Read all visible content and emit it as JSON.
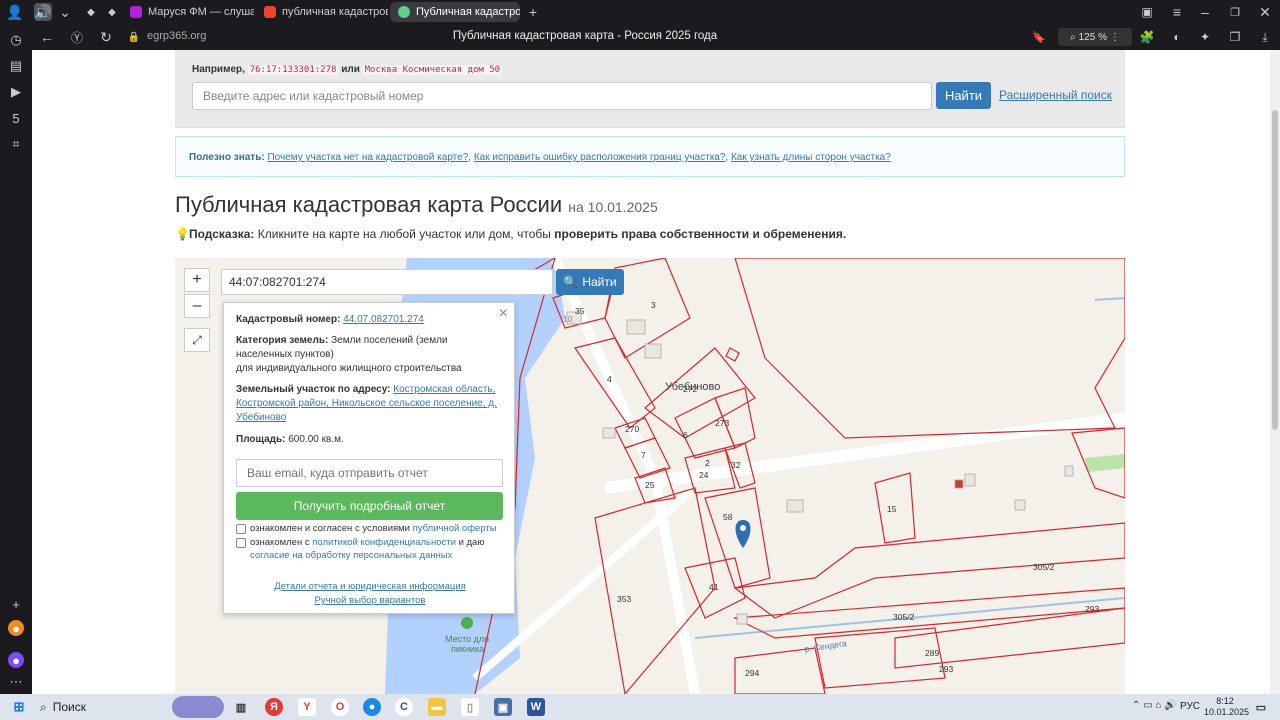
{
  "browser": {
    "tabs": [
      {
        "title": "Маруся ФМ — слуша",
        "fav_color": "#b620e0",
        "active": false
      },
      {
        "title": "публичная кадастровая",
        "fav_color": "#e8452c",
        "active": false
      },
      {
        "title": "Публичная кадастровая",
        "fav_color": "#5ad08e",
        "active": true
      }
    ],
    "url": "egrp365.org",
    "page_title": "Публичная кадастровая карта - Россия 2025 года",
    "zoom": "125 %"
  },
  "search": {
    "example_label": "Например,",
    "example_code1": "76:17:133301:278",
    "example_or": "или",
    "example_code2": "Москва Космическая дом 50",
    "placeholder": "Введите адрес или кадастровый номер",
    "button": "Найти",
    "advanced": "Расширенный поиск"
  },
  "info": {
    "label": "Полезно знать:",
    "link1": "Почему участка нет на кадастровой карте?",
    "sep1": ",",
    "link2": "Как исправить ошибку расположения границ участка?",
    "sep2": ",",
    "link3": "Как узнать длины сторон участка?"
  },
  "heading": {
    "title": "Публичная кадастровая карта России",
    "date": "на 10.01.2025"
  },
  "hint": {
    "label": "Подсказка:",
    "text": "Кликните на карте на любой участок или дом, чтобы",
    "bold": "проверить права собственности и обременения."
  },
  "map": {
    "zoom_in": "+",
    "zoom_out": "–",
    "search_value": "44:07:082701:274",
    "find_button": "Найти",
    "parcel_labels": [
      "3",
      "35",
      "10",
      "4",
      "272",
      "Убебиново",
      "270",
      "6",
      "273",
      "7",
      "2",
      "24",
      "32",
      "25",
      "58",
      "15",
      "41",
      "353",
      "305/2",
      "305/2",
      "293",
      "289",
      "293",
      "294"
    ],
    "place_label": "Место для пикника",
    "river_label": "р. Сендега"
  },
  "popup": {
    "cad_label": "Кадастровый номер:",
    "cad_value": "44.07.082701.274",
    "cat_label": "Категория земель:",
    "cat_value": "Земли поселений (земли населенных пунктов)",
    "usage": "для индивидуального жилищного строительства",
    "addr_label": "Земельный участок по адресу:",
    "addr_value": "Костромская область, Костромской район, Никольское сельское поселение, д. Убебиново",
    "area_label": "Площадь:",
    "area_value": "600.00 кв.м.",
    "email_placeholder": "Ваш email, куда отправить отчет",
    "report_button": "Получить подробный отчет",
    "chk1_text": "ознакомлен и согласен с условиями",
    "chk1_link": "публичной оферты",
    "chk2_text": "ознакомлен с",
    "chk2_link1": "политикой конфиденциальности",
    "chk2_and": "и даю",
    "chk2_link2": "согласие на обработку персональных данных",
    "footer1": "Детали отчета и юридическая информация",
    "footer2": "Ручной выбор вариантов"
  },
  "taskbar": {
    "search": "Поиск",
    "lang": "РУС",
    "time": "8:12",
    "date": "10.01.2025"
  }
}
